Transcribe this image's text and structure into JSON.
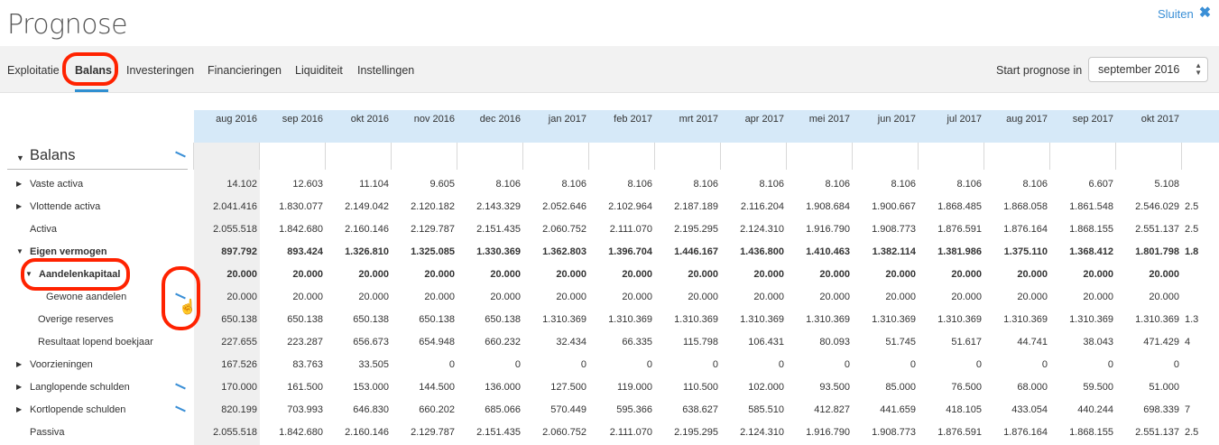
{
  "page": {
    "title": "Prognose",
    "close_label": "Sluiten"
  },
  "nav": {
    "tabs": [
      {
        "label": "Exploitatie"
      },
      {
        "label": "Balans"
      },
      {
        "label": "Investeringen"
      },
      {
        "label": "Financieringen"
      },
      {
        "label": "Liquiditeit"
      },
      {
        "label": "Instellingen"
      }
    ],
    "active_tab": "Balans",
    "start_label": "Start prognose in",
    "start_value": "september 2016"
  },
  "table": {
    "section_title": "Balans",
    "months": [
      "aug 2016",
      "sep 2016",
      "okt 2016",
      "nov 2016",
      "dec 2016",
      "jan 2017",
      "feb 2017",
      "mrt 2017",
      "apr 2017",
      "mei 2017",
      "jun 2017",
      "jul 2017",
      "aug 2017",
      "sep 2017",
      "okt 2017"
    ],
    "rows": [
      {
        "label": "Vaste activa",
        "expandable": true,
        "expanded": false,
        "bold": false,
        "values": [
          "14.102",
          "12.603",
          "11.104",
          "9.605",
          "8.106",
          "8.106",
          "8.106",
          "8.106",
          "8.106",
          "8.106",
          "8.106",
          "8.106",
          "8.106",
          "6.607",
          "5.108"
        ],
        "overflow": ""
      },
      {
        "label": "Vlottende activa",
        "expandable": true,
        "expanded": false,
        "bold": false,
        "values": [
          "2.041.416",
          "1.830.077",
          "2.149.042",
          "2.120.182",
          "2.143.329",
          "2.052.646",
          "2.102.964",
          "2.187.189",
          "2.116.204",
          "1.908.684",
          "1.900.667",
          "1.868.485",
          "1.868.058",
          "1.861.548",
          "2.546.029"
        ],
        "overflow": "2.5"
      },
      {
        "label": "Activa",
        "expandable": false,
        "bold": false,
        "values": [
          "2.055.518",
          "1.842.680",
          "2.160.146",
          "2.129.787",
          "2.151.435",
          "2.060.752",
          "2.111.070",
          "2.195.295",
          "2.124.310",
          "1.916.790",
          "1.908.773",
          "1.876.591",
          "1.876.164",
          "1.868.155",
          "2.551.137"
        ],
        "overflow": "2.5"
      },
      {
        "label": "Eigen vermogen",
        "expandable": true,
        "expanded": true,
        "bold": true,
        "values": [
          "897.792",
          "893.424",
          "1.326.810",
          "1.325.085",
          "1.330.369",
          "1.362.803",
          "1.396.704",
          "1.446.167",
          "1.436.800",
          "1.410.463",
          "1.382.114",
          "1.381.986",
          "1.375.110",
          "1.368.412",
          "1.801.798"
        ],
        "overflow": "1.8"
      },
      {
        "label": "Aandelenkapitaal",
        "expandable": true,
        "expanded": true,
        "bold": true,
        "values": [
          "20.000",
          "20.000",
          "20.000",
          "20.000",
          "20.000",
          "20.000",
          "20.000",
          "20.000",
          "20.000",
          "20.000",
          "20.000",
          "20.000",
          "20.000",
          "20.000",
          "20.000"
        ],
        "overflow": ""
      },
      {
        "label": "Gewone aandelen",
        "expandable": false,
        "bold": false,
        "values": [
          "20.000",
          "20.000",
          "20.000",
          "20.000",
          "20.000",
          "20.000",
          "20.000",
          "20.000",
          "20.000",
          "20.000",
          "20.000",
          "20.000",
          "20.000",
          "20.000",
          "20.000"
        ],
        "overflow": ""
      },
      {
        "label": "Overige reserves",
        "expandable": false,
        "bold": false,
        "values": [
          "650.138",
          "650.138",
          "650.138",
          "650.138",
          "650.138",
          "1.310.369",
          "1.310.369",
          "1.310.369",
          "1.310.369",
          "1.310.369",
          "1.310.369",
          "1.310.369",
          "1.310.369",
          "1.310.369",
          "1.310.369"
        ],
        "overflow": "1.3"
      },
      {
        "label": "Resultaat lopend boekjaar",
        "expandable": false,
        "bold": false,
        "values": [
          "227.655",
          "223.287",
          "656.673",
          "654.948",
          "660.232",
          "32.434",
          "66.335",
          "115.798",
          "106.431",
          "80.093",
          "51.745",
          "51.617",
          "44.741",
          "38.043",
          "471.429"
        ],
        "overflow": "4"
      },
      {
        "label": "Voorzieningen",
        "expandable": true,
        "expanded": false,
        "bold": false,
        "values": [
          "167.526",
          "83.763",
          "33.505",
          "0",
          "0",
          "0",
          "0",
          "0",
          "0",
          "0",
          "0",
          "0",
          "0",
          "0",
          "0"
        ],
        "overflow": ""
      },
      {
        "label": "Langlopende schulden",
        "expandable": true,
        "expanded": false,
        "bold": false,
        "values": [
          "170.000",
          "161.500",
          "153.000",
          "144.500",
          "136.000",
          "127.500",
          "119.000",
          "110.500",
          "102.000",
          "93.500",
          "85.000",
          "76.500",
          "68.000",
          "59.500",
          "51.000"
        ],
        "overflow": ""
      },
      {
        "label": "Kortlopende schulden",
        "expandable": true,
        "expanded": false,
        "bold": false,
        "values": [
          "820.199",
          "703.993",
          "646.830",
          "660.202",
          "685.066",
          "570.449",
          "595.366",
          "638.627",
          "585.510",
          "412.827",
          "441.659",
          "418.105",
          "433.054",
          "440.244",
          "698.339"
        ],
        "overflow": "7"
      },
      {
        "label": "Passiva",
        "expandable": false,
        "bold": false,
        "values": [
          "2.055.518",
          "1.842.680",
          "2.160.146",
          "2.129.787",
          "2.151.435",
          "2.060.752",
          "2.111.070",
          "2.195.295",
          "2.124.310",
          "1.916.790",
          "1.908.773",
          "1.876.591",
          "1.876.164",
          "1.868.155",
          "2.551.137"
        ],
        "overflow": "2.5"
      }
    ]
  }
}
